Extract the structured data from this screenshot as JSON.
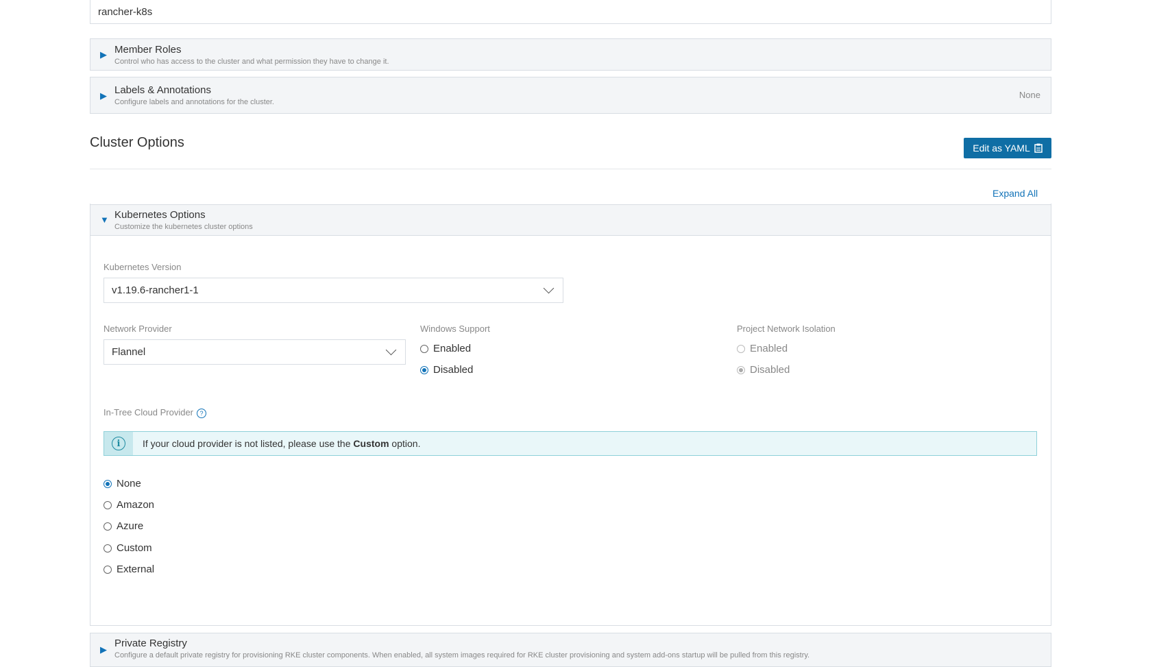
{
  "cluster_name": {
    "value": "rancher-k8s"
  },
  "member_roles": {
    "title": "Member Roles",
    "subtitle": "Control who has access to the cluster and what permission they have to change it."
  },
  "labels": {
    "title": "Labels & Annotations",
    "subtitle": "Configure labels and annotations for the cluster.",
    "status": "None"
  },
  "cluster_options": {
    "title": "Cluster Options",
    "edit_yaml_label": "Edit as YAML",
    "expand_all": "Expand All"
  },
  "kubernetes": {
    "title": "Kubernetes Options",
    "subtitle": "Customize the kubernetes cluster options",
    "version_label": "Kubernetes Version",
    "version_value": "v1.19.6-rancher1-1",
    "network_label": "Network Provider",
    "network_value": "Flannel",
    "windows_label": "Windows Support",
    "windows_options": [
      "Enabled",
      "Disabled"
    ],
    "windows_selected": "Disabled",
    "isolation_label": "Project Network Isolation",
    "isolation_options": [
      "Enabled",
      "Disabled"
    ],
    "isolation_selected": "Disabled",
    "cloud_label": "In-Tree Cloud Provider",
    "banner_prefix": "If your cloud provider is not listed, please use the",
    "banner_bold": "Custom",
    "banner_suffix": "option.",
    "cloud_options": [
      "None",
      "Amazon",
      "Azure",
      "Custom",
      "External"
    ],
    "cloud_selected": "None"
  },
  "private_registry": {
    "title": "Private Registry",
    "subtitle": "Configure a default private registry for provisioning RKE cluster components. When enabled, all system images required for RKE cluster provisioning and system add-ons startup will be pulled from this registry."
  },
  "colors": {
    "accent": "#1273b8",
    "button": "#0f6ea5",
    "banner_bg": "#e9f7f9"
  }
}
